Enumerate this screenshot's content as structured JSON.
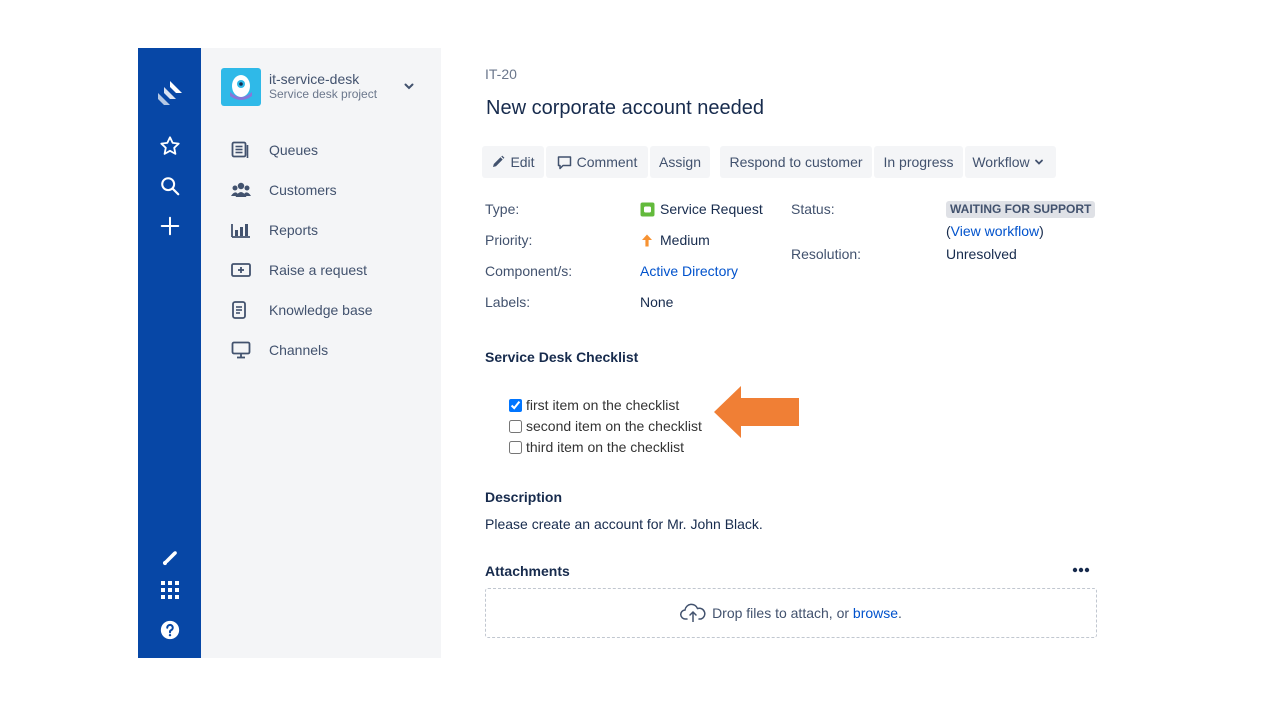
{
  "project": {
    "name": "it-service-desk",
    "subtitle": "Service desk project"
  },
  "sidebar": {
    "items": [
      {
        "label": "Queues"
      },
      {
        "label": "Customers"
      },
      {
        "label": "Reports"
      },
      {
        "label": "Raise a request"
      },
      {
        "label": "Knowledge base"
      },
      {
        "label": "Channels"
      }
    ]
  },
  "issue": {
    "key": "IT-20",
    "title": "New corporate account needed"
  },
  "toolbar": {
    "edit": "Edit",
    "comment": "Comment",
    "assign": "Assign",
    "respond": "Respond to customer",
    "in_progress": "In progress",
    "workflow": "Workflow"
  },
  "details": {
    "type_label": "Type:",
    "type_value": "Service Request",
    "priority_label": "Priority:",
    "priority_value": "Medium",
    "component_label": "Component/s:",
    "component_value": "Active Directory",
    "labels_label": "Labels:",
    "labels_value": "None",
    "status_label": "Status:",
    "status_value": "WAITING FOR SUPPORT",
    "view_workflow_open": "(",
    "view_workflow": "View workflow",
    "view_workflow_close": ")",
    "resolution_label": "Resolution:",
    "resolution_value": "Unresolved"
  },
  "checklist": {
    "heading": "Service Desk Checklist",
    "items": [
      {
        "label": "first item on the checklist",
        "checked": true
      },
      {
        "label": "second item on the checklist",
        "checked": false
      },
      {
        "label": "third item on the checklist",
        "checked": false
      }
    ]
  },
  "description": {
    "heading": "Description",
    "text": "Please create an account for Mr. John Black."
  },
  "attachments": {
    "heading": "Attachments",
    "drop_text": "Drop files to attach, or ",
    "browse": "browse",
    "period": "."
  },
  "icons": {
    "global_nav": [
      "jira-logo-icon",
      "star-icon",
      "search-icon",
      "plus-icon",
      "notifications-icon",
      "app-switcher-icon",
      "help-icon"
    ],
    "sidebar": [
      "queues-icon",
      "customers-icon",
      "reports-icon",
      "raise-request-icon",
      "knowledge-base-icon",
      "channels-icon"
    ]
  },
  "colors": {
    "global_nav_bg": "#0747a6",
    "sidebar_bg": "#f4f5f7",
    "link": "#0052cc",
    "annotation_arrow": "#f07f35",
    "service_request_icon": "#63ba3c",
    "priority_medium": "#f79232"
  }
}
